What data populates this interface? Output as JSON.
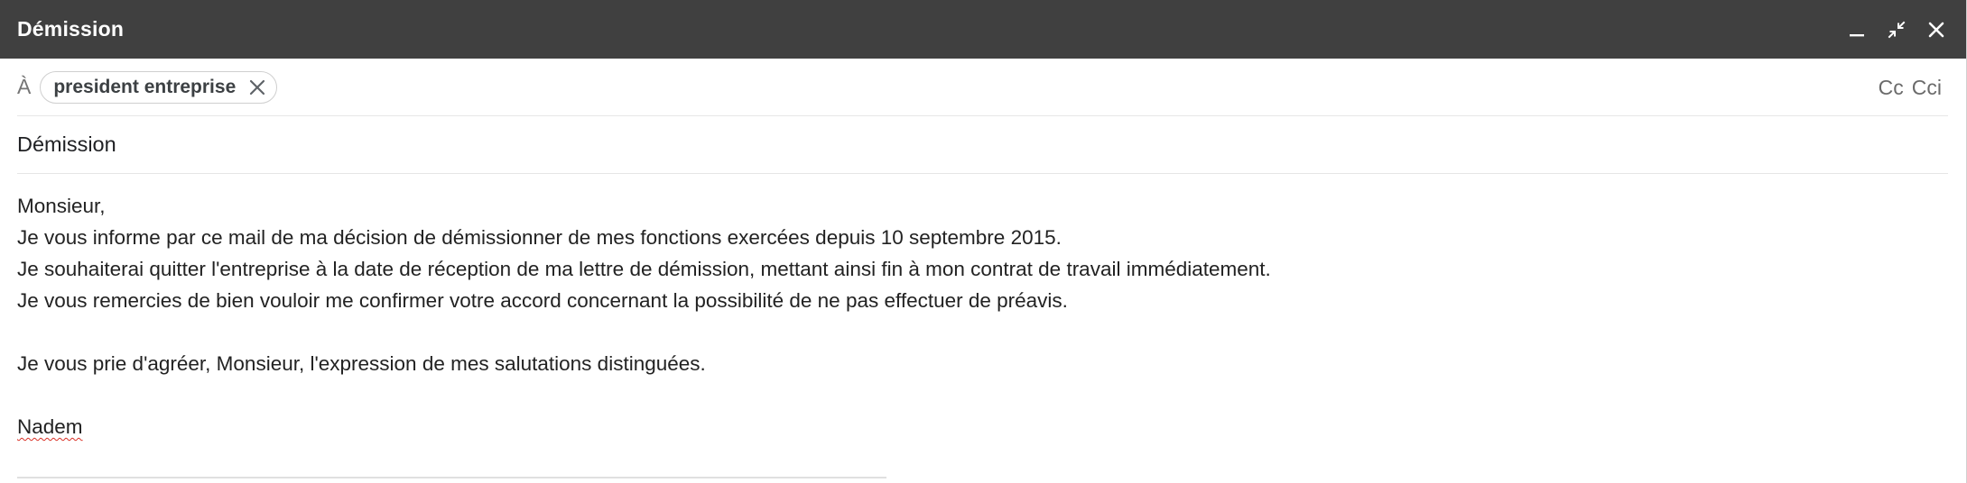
{
  "window": {
    "title": "Démission",
    "controls": {
      "minimize_icon": "minimize-icon",
      "exit_fullscreen_icon": "exit-fullscreen-icon",
      "close_icon": "close-icon"
    }
  },
  "to": {
    "label": "À",
    "recipient": "president entreprise",
    "remove_icon": "close-icon"
  },
  "cc": {
    "cc_label": "Cc",
    "bcc_label": "Cci"
  },
  "subject": {
    "value": "Démission"
  },
  "body": {
    "lines": [
      "Monsieur,",
      "Je vous informe par ce mail de ma décision de démissionner de mes fonctions exercées depuis 10 septembre 2015.",
      "Je souhaiterai quitter l'entreprise à la date de réception de ma lettre de démission, mettant ainsi fin à mon contrat de travail immédiatement.",
      "Je vous remercies de bien vouloir me confirmer votre accord concernant la possibilité de ne pas effectuer de préavis."
    ],
    "closing": "Je vous prie d'agréer, Monsieur, l'expression de mes salutations distinguées.",
    "signature": "Nadem"
  },
  "colors": {
    "titlebar": "#404040",
    "spellcheck": "#d93025"
  }
}
